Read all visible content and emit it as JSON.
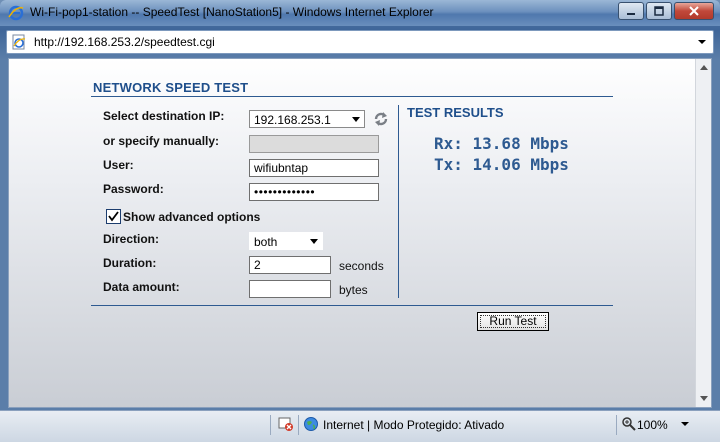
{
  "window": {
    "title": "Wi-Fi-pop1-station -- SpeedTest [NanoStation5] - Windows Internet Explorer"
  },
  "address": {
    "url": "http://192.168.253.2/speedtest.cgi"
  },
  "form": {
    "section_title": "NETWORK SPEED TEST",
    "dest_ip_label": "Select destination IP:",
    "dest_ip_value": "192.168.253.1",
    "manual_label": "or specify manually:",
    "manual_value": "",
    "user_label": "User:",
    "user_value": "wifiubntap",
    "password_label": "Password:",
    "password_value": "•••••••••••••",
    "advanced_label": "Show advanced options",
    "advanced_checked": true,
    "direction_label": "Direction:",
    "direction_value": "both",
    "duration_label": "Duration:",
    "duration_value": "2",
    "duration_unit": "seconds",
    "amount_label": "Data amount:",
    "amount_value": "",
    "amount_unit": "bytes",
    "run_label": "Run Test"
  },
  "results": {
    "title": "TEST RESULTS",
    "rx": "Rx: 13.68 Mbps",
    "tx": "Tx: 14.06 Mbps"
  },
  "statusbar": {
    "zone": "Internet | Modo Protegido: Ativado",
    "zoom": "100%"
  },
  "colors": {
    "accent": "#1f4f8b",
    "result_text": "#2e5a91"
  }
}
